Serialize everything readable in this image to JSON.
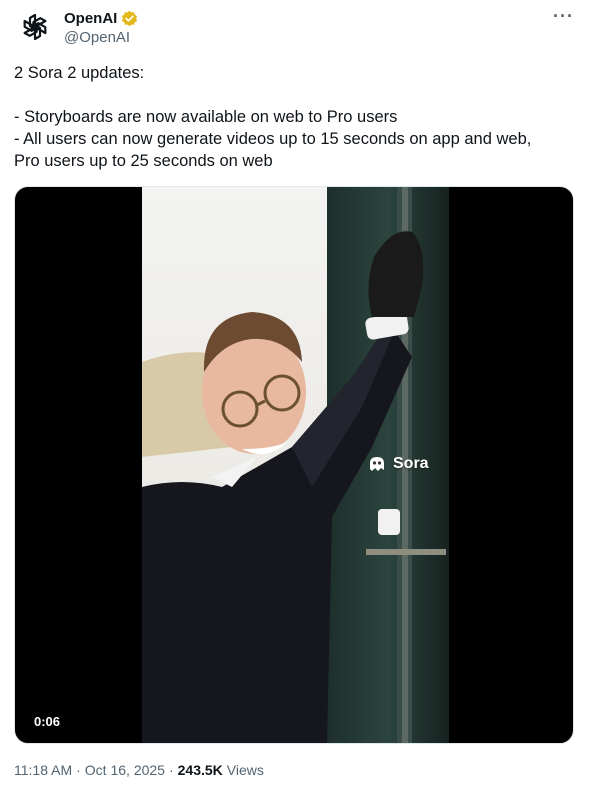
{
  "author": {
    "display_name": "OpenAI",
    "handle": "@OpenAI",
    "avatar_icon": "openai-logo-icon",
    "verified_icon": "gold-verified-badge-icon"
  },
  "more_icon": "more-dots-icon",
  "tweet": {
    "lines": [
      "2 Sora 2 updates:",
      "",
      "- Storyboards are now available on web to Pro users",
      "- All users can now generate videos up to 15 seconds on app and web,",
      "Pro users up to 25 seconds on web"
    ]
  },
  "media": {
    "duration": "0:06",
    "watermark_text": "Sora",
    "watermark_icon": "sora-logo-icon"
  },
  "meta": {
    "time": "11:18 AM",
    "date": "Oct 16, 2025",
    "views_count": "243.5K",
    "views_label": "Views",
    "separator": "·"
  },
  "colors": {
    "text_primary": "#0f1419",
    "text_secondary": "#536471",
    "verified_gold": "#e2b719"
  }
}
